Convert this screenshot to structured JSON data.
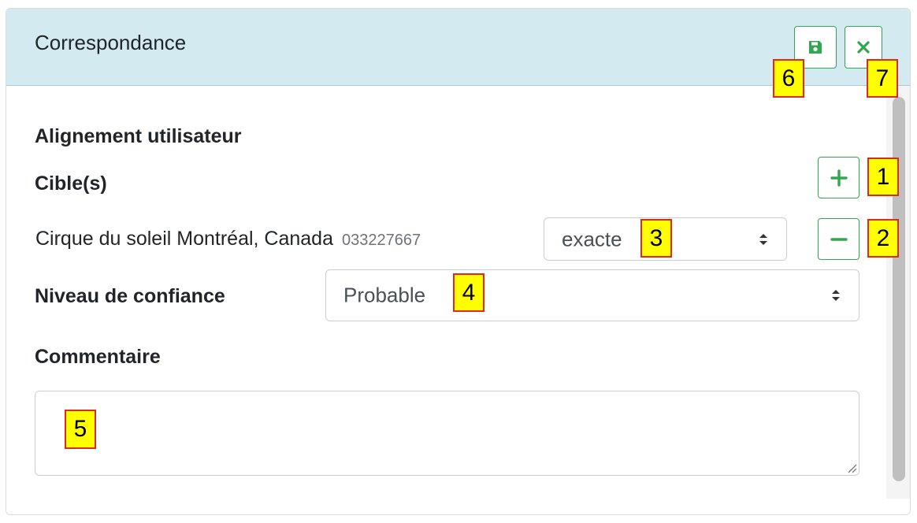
{
  "header": {
    "title": "Correspondance"
  },
  "sections": {
    "user_alignment": "Alignement utilisateur",
    "targets": "Cible(s)",
    "confidence_label": "Niveau de confiance",
    "comment_label": "Commentaire"
  },
  "target": {
    "name": "Cirque du soleil Montréal, Canada",
    "code": "033227667",
    "match_type": "exacte"
  },
  "confidence": {
    "value": "Probable"
  },
  "comment": {
    "value": ""
  },
  "annotations": {
    "add": "1",
    "remove": "2",
    "match": "3",
    "confidence": "4",
    "comment": "5",
    "save": "6",
    "close": "7"
  },
  "colors": {
    "header_bg": "#d3ebf0",
    "accent_green": "#2fa84f",
    "badge_yellow": "#ffff00",
    "badge_border": "#e0291b"
  },
  "icons": {
    "save": "floppy-disk-icon",
    "close": "x-icon",
    "add": "plus-icon",
    "remove": "minus-icon"
  }
}
